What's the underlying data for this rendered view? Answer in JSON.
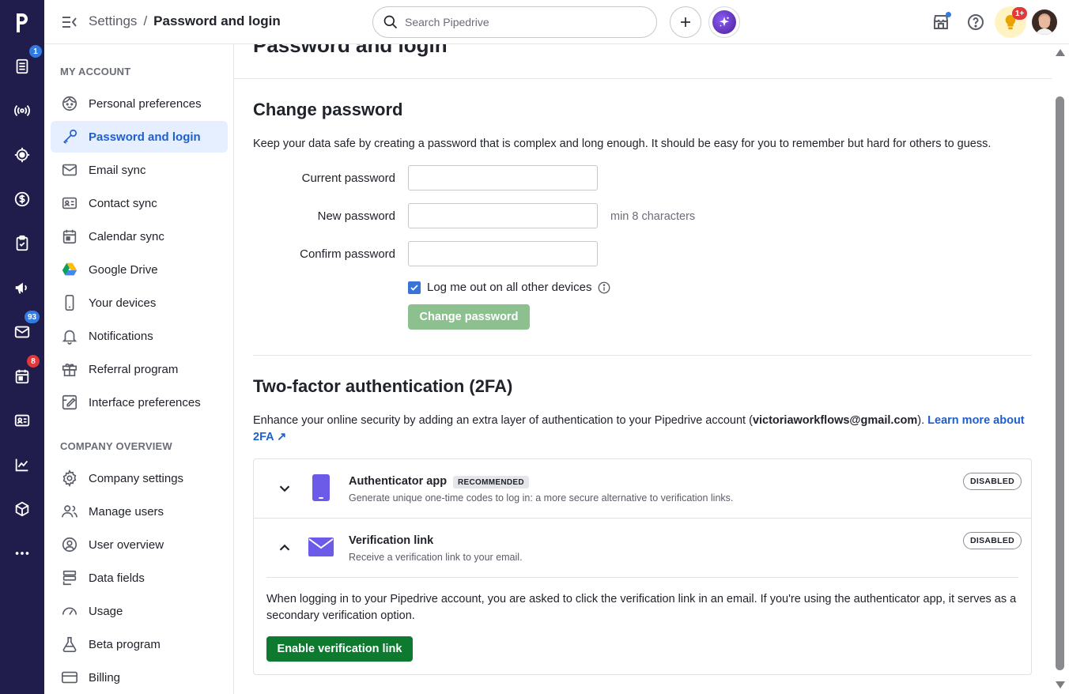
{
  "app": {
    "name": "Pipedrive",
    "logo_letter": "p"
  },
  "rail": {
    "items": [
      {
        "icon": "leads-icon",
        "badge": "1",
        "badge_color": "#317ae2"
      },
      {
        "icon": "broadcast-icon"
      },
      {
        "icon": "target-icon"
      },
      {
        "icon": "deals-icon"
      },
      {
        "icon": "activities-icon"
      },
      {
        "icon": "campaigns-icon"
      },
      {
        "icon": "mail-icon",
        "badge": "93",
        "badge_color": "#317ae2"
      },
      {
        "icon": "calendar-icon",
        "badge": "8",
        "badge_color": "#e0383b"
      },
      {
        "icon": "contacts-icon"
      },
      {
        "icon": "insights-icon"
      },
      {
        "icon": "products-icon"
      },
      {
        "icon": "more-icon"
      }
    ]
  },
  "topbar": {
    "breadcrumb_parent": "Settings",
    "breadcrumb_sep": "/",
    "breadcrumb_current": "Password and login",
    "search_placeholder": "Search Pipedrive",
    "bulb_badge": "1+"
  },
  "sidebar": {
    "my_account_title": "MY ACCOUNT",
    "my_account_items": [
      {
        "label": "Personal preferences",
        "icon": "face-icon"
      },
      {
        "label": "Password and login",
        "icon": "key-icon",
        "active": true
      },
      {
        "label": "Email sync",
        "icon": "envelope-icon"
      },
      {
        "label": "Contact sync",
        "icon": "contact-card-icon"
      },
      {
        "label": "Calendar sync",
        "icon": "calendar-sync-icon"
      },
      {
        "label": "Google Drive",
        "icon": "google-drive-icon"
      },
      {
        "label": "Your devices",
        "icon": "phone-icon"
      },
      {
        "label": "Notifications",
        "icon": "bell-icon"
      },
      {
        "label": "Referral program",
        "icon": "gift-icon"
      },
      {
        "label": "Interface preferences",
        "icon": "interface-icon"
      }
    ],
    "company_title": "COMPANY OVERVIEW",
    "company_items": [
      {
        "label": "Company settings",
        "icon": "gear-icon"
      },
      {
        "label": "Manage users",
        "icon": "users-icon"
      },
      {
        "label": "User overview",
        "icon": "user-circle-icon"
      },
      {
        "label": "Data fields",
        "icon": "data-fields-icon"
      },
      {
        "label": "Usage",
        "icon": "gauge-icon"
      },
      {
        "label": "Beta program",
        "icon": "flask-icon"
      },
      {
        "label": "Billing",
        "icon": "credit-card-icon"
      }
    ]
  },
  "main": {
    "page_title": "Password and login",
    "change_password": {
      "title": "Change password",
      "description": "Keep your data safe by creating a password that is complex and long enough. It should be easy for you to remember but hard for others to guess.",
      "current_label": "Current password",
      "current_value": "",
      "new_label": "New password",
      "new_value": "",
      "new_hint": "min 8 characters",
      "confirm_label": "Confirm password",
      "confirm_value": "",
      "logout_label": "Log me out on all other devices",
      "logout_checked": true,
      "button": "Change password"
    },
    "two_factor": {
      "title": "Two-factor authentication (2FA)",
      "desc_before": "Enhance your online security by adding an extra layer of authentication to your Pipedrive account (",
      "email": "victoriaworkflows@gmail.com",
      "desc_after": "). ",
      "learn_more": "Learn more about 2FA",
      "learn_more_arrow": "↗",
      "methods": [
        {
          "title": "Authenticator app",
          "tag": "RECOMMENDED",
          "subtitle": "Generate unique one-time codes to log in: a more secure alternative to verification links.",
          "status": "DISABLED",
          "expanded": false
        },
        {
          "title": "Verification link",
          "subtitle": "Receive a verification link to your email.",
          "status": "DISABLED",
          "expanded": true,
          "details": "When logging in to your Pipedrive account, you are asked to click the verification link in an email. If you're using the authenticator app, it serves as a secondary verification option.",
          "button": "Enable verification link"
        }
      ]
    }
  },
  "colors": {
    "rail_bg": "#201c4b",
    "active_bg": "#e6efff",
    "link": "#1e5fd0",
    "disabled_green": "#8cc08f",
    "primary_green": "#0e7a2f",
    "icon_purple": "#6b5be8"
  }
}
